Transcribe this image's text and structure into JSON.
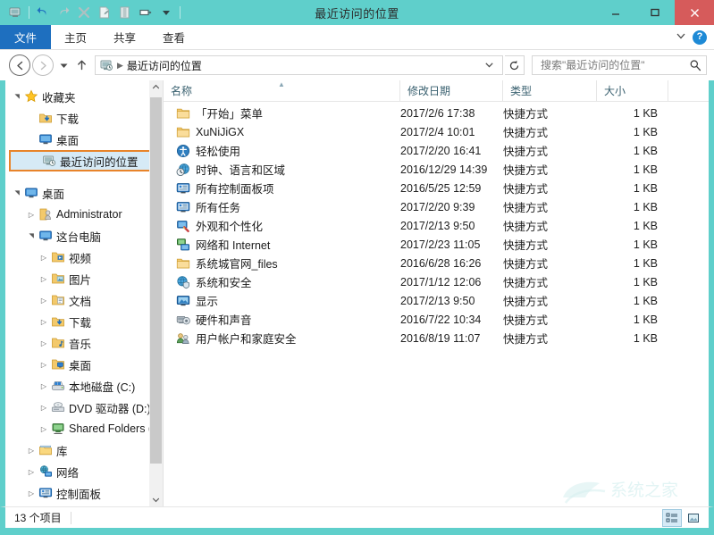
{
  "window": {
    "title": "最近访问的位置",
    "minimize_label": "最小化",
    "maximize_label": "最大化",
    "close_label": "关闭"
  },
  "quick_access": {
    "items": [
      {
        "name": "properties-icon",
        "label": "属性"
      },
      {
        "name": "undo-icon",
        "label": "撤消"
      },
      {
        "name": "redo-icon",
        "label": "恢复"
      },
      {
        "name": "delete-icon",
        "label": "删除"
      },
      {
        "name": "new-folder-icon",
        "label": "新建文件夹"
      },
      {
        "name": "paste-icon",
        "label": "粘贴"
      },
      {
        "name": "rename-icon",
        "label": "重命名"
      },
      {
        "name": "customize-dropdown-icon",
        "label": "自定义快速访问工具栏"
      }
    ]
  },
  "ribbon": {
    "file_tab": "文件",
    "tabs": [
      "主页",
      "共享",
      "查看"
    ],
    "minimize_ribbon_label": "展开功能区",
    "help_label": "?"
  },
  "address": {
    "back_label": "后退",
    "forward_label": "前进",
    "recent_label": "最近浏览的位置",
    "up_label": "上移到",
    "crumb": "最近访问的位置",
    "refresh_label": "刷新"
  },
  "search": {
    "value": "",
    "placeholder": "搜索\"最近访问的位置\""
  },
  "sidebar": {
    "items": [
      {
        "label": "收藏夹",
        "level": 1,
        "arrow": "expanded",
        "icon": "star-icon",
        "selected": false
      },
      {
        "label": "下载",
        "level": 2,
        "arrow": "none",
        "icon": "download-folder-icon",
        "selected": false
      },
      {
        "label": "桌面",
        "level": 2,
        "arrow": "none",
        "icon": "desktop-icon",
        "selected": false
      },
      {
        "label": "最近访问的位置",
        "level": 2,
        "arrow": "none",
        "icon": "recent-places-icon",
        "selected": true
      },
      {
        "label": "桌面",
        "level": 1,
        "arrow": "expanded",
        "icon": "desktop-icon",
        "selected": false
      },
      {
        "label": "Administrator",
        "level": 2,
        "arrow": "collapsed",
        "icon": "user-folder-icon",
        "selected": false
      },
      {
        "label": "这台电脑",
        "level": 2,
        "arrow": "expanded",
        "icon": "computer-icon",
        "selected": false
      },
      {
        "label": "视频",
        "level": 3,
        "arrow": "collapsed",
        "icon": "videos-folder-icon",
        "selected": false
      },
      {
        "label": "图片",
        "level": 3,
        "arrow": "collapsed",
        "icon": "pictures-folder-icon",
        "selected": false
      },
      {
        "label": "文档",
        "level": 3,
        "arrow": "collapsed",
        "icon": "documents-folder-icon",
        "selected": false
      },
      {
        "label": "下载",
        "level": 3,
        "arrow": "collapsed",
        "icon": "download-folder-icon",
        "selected": false
      },
      {
        "label": "音乐",
        "level": 3,
        "arrow": "collapsed",
        "icon": "music-folder-icon",
        "selected": false
      },
      {
        "label": "桌面",
        "level": 3,
        "arrow": "collapsed",
        "icon": "desktop-folder-icon",
        "selected": false
      },
      {
        "label": "本地磁盘 (C:)",
        "level": 3,
        "arrow": "collapsed",
        "icon": "hard-drive-icon",
        "selected": false
      },
      {
        "label": "DVD 驱动器 (D:)",
        "level": 3,
        "arrow": "collapsed",
        "icon": "dvd-drive-icon",
        "selected": false
      },
      {
        "label": "Shared Folders (\\",
        "level": 3,
        "arrow": "collapsed",
        "icon": "network-drive-icon",
        "selected": false
      },
      {
        "label": "库",
        "level": 2,
        "arrow": "collapsed",
        "icon": "library-icon",
        "selected": false
      },
      {
        "label": "网络",
        "level": 2,
        "arrow": "collapsed",
        "icon": "network-icon",
        "selected": false
      },
      {
        "label": "控制面板",
        "level": 2,
        "arrow": "collapsed",
        "icon": "control-panel-icon",
        "selected": false
      }
    ]
  },
  "filelist": {
    "columns": [
      {
        "key": "name",
        "label": "名称"
      },
      {
        "key": "date",
        "label": "修改日期"
      },
      {
        "key": "type",
        "label": "类型"
      },
      {
        "key": "size",
        "label": "大小"
      }
    ],
    "sorted_column": "name",
    "rows": [
      {
        "name": "「开始」菜单",
        "date": "2017/2/6 17:38",
        "type": "快捷方式",
        "size": "1 KB",
        "icon": "folder-icon"
      },
      {
        "name": "XuNiJiGX",
        "date": "2017/2/4 10:01",
        "type": "快捷方式",
        "size": "1 KB",
        "icon": "folder-icon"
      },
      {
        "name": "轻松使用",
        "date": "2017/2/20 16:41",
        "type": "快捷方式",
        "size": "1 KB",
        "icon": "ease-of-access-icon"
      },
      {
        "name": "时钟、语言和区域",
        "date": "2016/12/29 14:39",
        "type": "快捷方式",
        "size": "1 KB",
        "icon": "clock-region-icon"
      },
      {
        "name": "所有控制面板项",
        "date": "2016/5/25 12:59",
        "type": "快捷方式",
        "size": "1 KB",
        "icon": "control-panel-icon"
      },
      {
        "name": "所有任务",
        "date": "2017/2/20 9:39",
        "type": "快捷方式",
        "size": "1 KB",
        "icon": "control-panel-icon"
      },
      {
        "name": "外观和个性化",
        "date": "2017/2/13 9:50",
        "type": "快捷方式",
        "size": "1 KB",
        "icon": "appearance-icon"
      },
      {
        "name": "网络和 Internet",
        "date": "2017/2/23 11:05",
        "type": "快捷方式",
        "size": "1 KB",
        "icon": "network-internet-icon"
      },
      {
        "name": "系统城官网_files",
        "date": "2016/6/28 16:26",
        "type": "快捷方式",
        "size": "1 KB",
        "icon": "folder-icon"
      },
      {
        "name": "系统和安全",
        "date": "2017/1/12 12:06",
        "type": "快捷方式",
        "size": "1 KB",
        "icon": "system-security-icon"
      },
      {
        "name": "显示",
        "date": "2017/2/13 9:50",
        "type": "快捷方式",
        "size": "1 KB",
        "icon": "display-icon"
      },
      {
        "name": "硬件和声音",
        "date": "2016/7/22 10:34",
        "type": "快捷方式",
        "size": "1 KB",
        "icon": "hardware-sound-icon"
      },
      {
        "name": "用户帐户和家庭安全",
        "date": "2016/8/19 11:07",
        "type": "快捷方式",
        "size": "1 KB",
        "icon": "user-accounts-icon"
      }
    ]
  },
  "status": {
    "item_count": "13 个项目",
    "details_view_label": "详细信息",
    "large_icons_view_label": "大图标"
  },
  "watermark": {
    "text": "系统之家"
  },
  "colors": {
    "frame": "#5FCFCB",
    "file_tab": "#1E6FBF",
    "close": "#D65B5B",
    "selection_border": "#E8842A",
    "selection_fill": "#D6EAF6",
    "header_text": "#39606F"
  }
}
